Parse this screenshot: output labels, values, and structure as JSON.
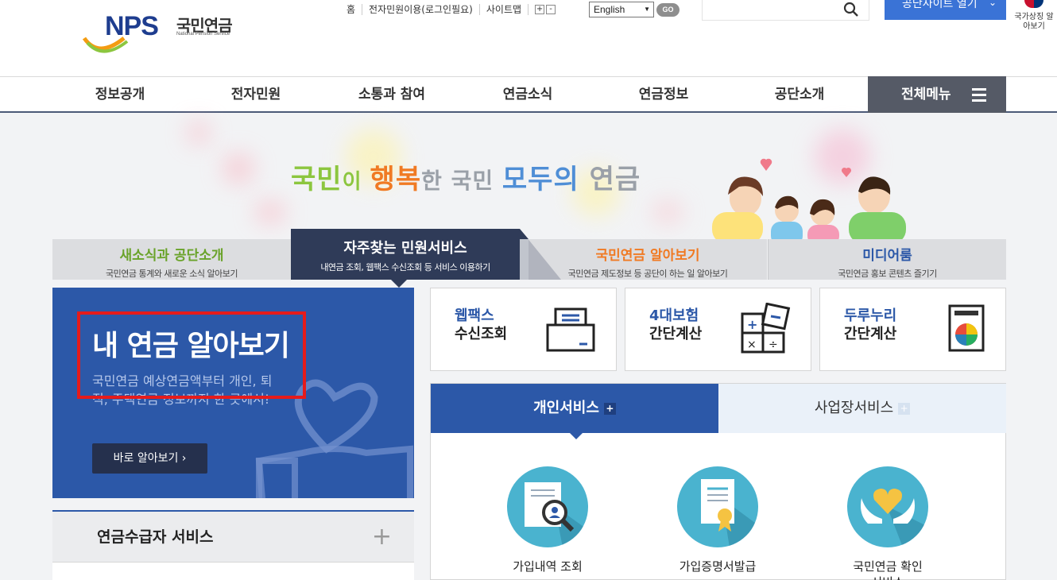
{
  "header": {
    "logo_text": "NPS",
    "logo_kr": "국민연금",
    "logo_en": "National Pension Service",
    "util": [
      "홈",
      "전자민원이용(로그인필요)",
      "사이트맵"
    ],
    "zoom_in": "+",
    "zoom_out": "-",
    "language": "English",
    "go": "GO",
    "site_button": "공단사이트 열기",
    "symbol_label": "국가상징 알아보기"
  },
  "nav": {
    "items": [
      "정보공개",
      "전자민원",
      "소통과 참여",
      "연금소식",
      "연금정보",
      "공단소개"
    ],
    "all_menu": "전체메뉴"
  },
  "banner": {
    "slogan_parts": [
      "국민",
      "이 ",
      "행복",
      "한 국민 ",
      "모두의",
      " 연금"
    ]
  },
  "tabs": [
    {
      "title": "새소식과 공단소개",
      "sub": "국민연금 통계와 새로운 소식 알아보기",
      "color": "#6aa32a"
    },
    {
      "title": "자주찾는 민원서비스",
      "sub": "내연금 조회, 웹팩스 수신조회 등 서비스 이용하기",
      "color": "#ffffff"
    },
    {
      "title": "국민연금 알아보기",
      "sub": "국민연금 제도정보 등 공단이 하는 일 알아보기",
      "color": "#f07a23"
    },
    {
      "title": "미디어룸",
      "sub": "국민연금 홍보 콘텐츠 즐기기",
      "color": "#2c58a8"
    }
  ],
  "pension": {
    "title": "내 연금 알아보기",
    "desc": "국민연금 예상연금액부터 개인, 퇴직, 주택연금 정보까지 한 곳에서!",
    "button": "바로 알아보기 ›"
  },
  "receiver": {
    "title": "연금수급자 서비스",
    "plus": "+"
  },
  "cards": [
    {
      "l1": "웹팩스",
      "l2": "수신조회"
    },
    {
      "l1": "4대보험",
      "l2": "간단계산"
    },
    {
      "l1": "두루누리",
      "l2": "간단계산"
    }
  ],
  "service": {
    "tab_personal": "개인서비스",
    "tab_business": "사업장서비스",
    "plus": "+",
    "items": [
      "가입내역 조회",
      "가입증명서발급",
      "국민연금 확인서비스"
    ]
  }
}
